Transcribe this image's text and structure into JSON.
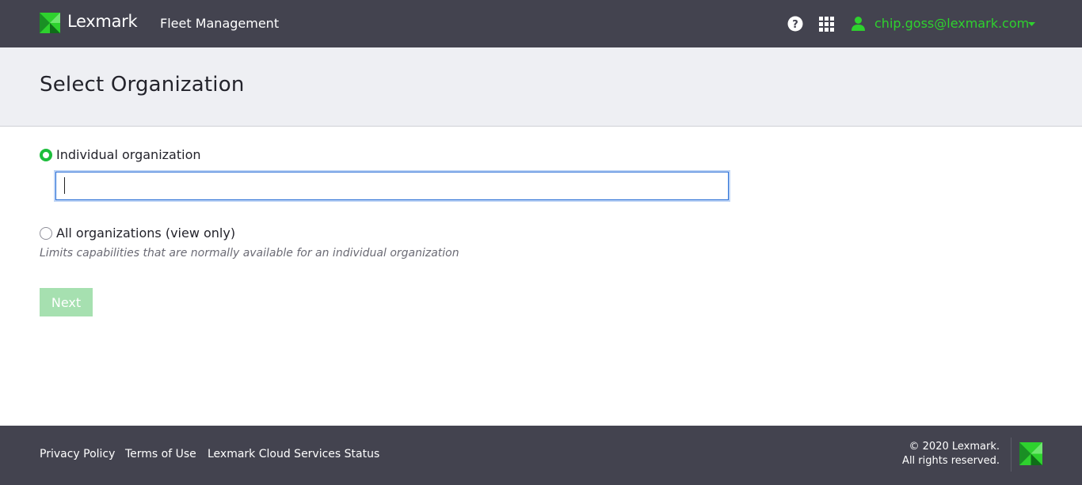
{
  "header": {
    "brand": "Lexmark",
    "product": "Fleet Management",
    "icons": [
      "help-icon",
      "apps-grid-icon",
      "user-icon",
      "caret-down-icon"
    ],
    "user_email": "chip.goss@lexmark.com"
  },
  "page": {
    "title": "Select Organization"
  },
  "form": {
    "option_individual": {
      "label": "Individual organization",
      "selected": true,
      "input_value": "",
      "input_placeholder": ""
    },
    "option_all": {
      "label": "All organizations (view only)",
      "selected": false,
      "hint": "Limits capabilities that are normally available for an individual organization"
    },
    "next_label": "Next",
    "next_enabled": false
  },
  "footer": {
    "links": [
      "Privacy Policy",
      "Terms of Use",
      "Lexmark Cloud Services Status"
    ],
    "copyright_line1": "© 2020 Lexmark.",
    "copyright_line2": "All rights reserved."
  },
  "colors": {
    "header_bg": "#43434f",
    "accent_green": "#2ed12e",
    "radio_green": "#1dbe3c",
    "button_disabled": "#a6e0b0",
    "title_band_bg": "#eeeff3"
  }
}
